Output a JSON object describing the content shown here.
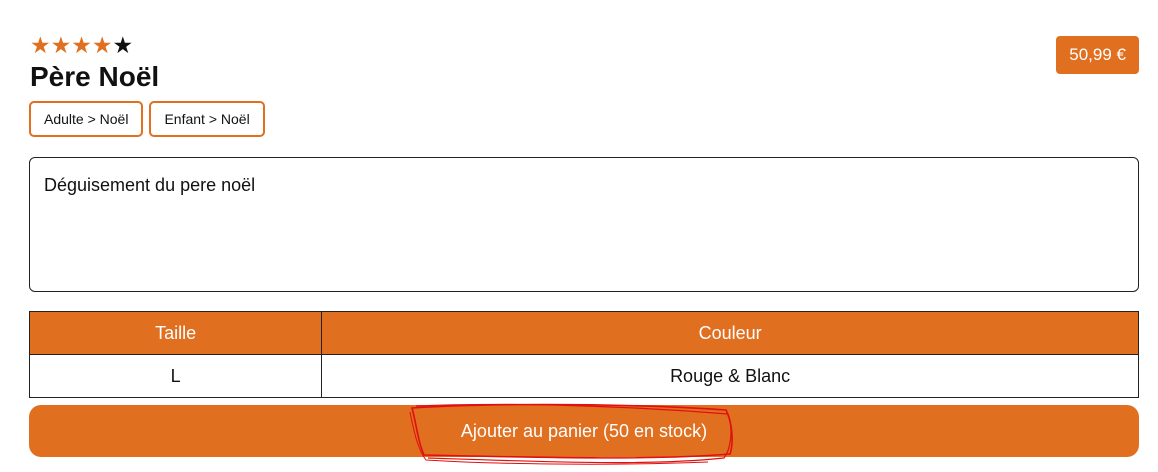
{
  "product": {
    "rating": {
      "value": 4,
      "max": 5
    },
    "name": "Père Noël",
    "price": "50,99 €",
    "categories": [
      "Adulte > Noël",
      "Enfant > Noël"
    ],
    "description": "Déguisement du pere noël"
  },
  "specs": {
    "headers": [
      "Taille",
      "Couleur"
    ],
    "rows": [
      [
        "L",
        "Rouge & Blanc"
      ]
    ]
  },
  "cart_button": {
    "label": "Ajouter au panier (50 en stock)"
  },
  "colors": {
    "accent": "#e06f20",
    "annotation": "#e01010"
  },
  "icons": {
    "star_filled": "star-filled-icon",
    "star_empty": "star-empty-icon"
  }
}
